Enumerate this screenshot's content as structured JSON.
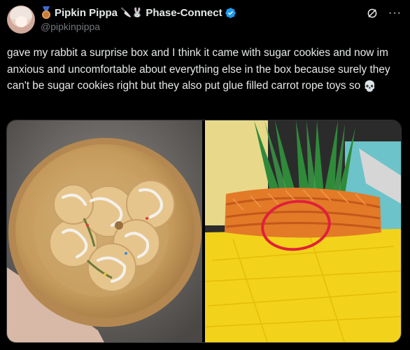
{
  "author": {
    "display_name": "Pipkin Pippa",
    "emoji_text": "🔪🐰",
    "affiliation": "Phase-Connect",
    "handle": "@pipkinpippa",
    "avatar_icon": "avatar-anime-girl",
    "badge_icon": "medal-icon",
    "verified_icon": "verified-check-icon",
    "verified_color": "#1d9bf0"
  },
  "actions": {
    "grok_icon": "grok-icon",
    "more_label": "···"
  },
  "tweet": {
    "text": "gave my rabbit a surprise box and I think it came with sugar cookies and now im anxious and uncomfortable about everything else in the box because surely they can't be sugar cookies right but they also put glue filled carrot rope toys so ",
    "emoji": "💀"
  },
  "media": {
    "photos": [
      {
        "subject": "bamboo-plate-with-iced-cookies"
      },
      {
        "subject": "carrot-rope-toy-with-red-circle"
      }
    ],
    "highlight_color": "#e0203a"
  }
}
